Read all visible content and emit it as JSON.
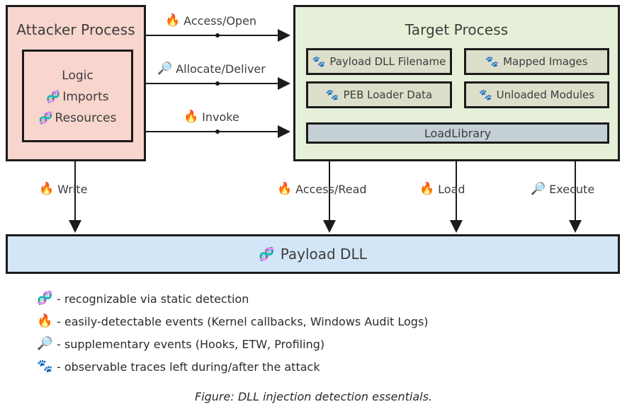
{
  "diagram": {
    "attacker_process": {
      "title": "Attacker Process",
      "inner": {
        "rows": [
          {
            "icon": "",
            "label": "Logic"
          },
          {
            "icon": "🧬",
            "label": "Imports"
          },
          {
            "icon": "🧬",
            "label": "Resources"
          }
        ]
      }
    },
    "target_process": {
      "title": "Target Process",
      "cells": [
        {
          "icon": "🐾",
          "label": "Payload DLL Filename"
        },
        {
          "icon": "🐾",
          "label": "Mapped Images"
        },
        {
          "icon": "🐾",
          "label": "PEB Loader Data"
        },
        {
          "icon": "🐾",
          "label": "Unloaded Modules"
        }
      ],
      "loadlibrary": {
        "icon": "",
        "label": "LoadLibrary"
      }
    },
    "payload_dll": {
      "icon": "🧬",
      "label": "Payload DLL"
    },
    "horizontal_arrows": [
      {
        "icon": "🔥",
        "label": "Access/Open"
      },
      {
        "icon": "🔎",
        "label": "Allocate/Deliver"
      },
      {
        "icon": "🔥",
        "label": "Invoke"
      }
    ],
    "vertical_arrows": [
      {
        "icon": "🔥",
        "label": "Write"
      },
      {
        "icon": "🔥",
        "label": "Access/Read"
      },
      {
        "icon": "🔥",
        "label": "Load"
      },
      {
        "icon": "🔎",
        "label": "Execute"
      }
    ]
  },
  "legend": {
    "items": [
      {
        "icon": "🧬",
        "text": "- recognizable via static detection"
      },
      {
        "icon": "🔥",
        "text": "- easily-detectable events (Kernel callbacks, Windows Audit Logs)"
      },
      {
        "icon": "🔎",
        "text": "- supplementary events (Hooks, ETW, Profiling)"
      },
      {
        "icon": "🐾",
        "text": "- observable traces left during/after the attack"
      }
    ]
  },
  "caption": "Figure: DLL injection detection essentials.",
  "colors": {
    "attacker_fill": "#f8d5cd",
    "target_fill": "#e6f0d8",
    "cell_fill": "#dcdfca",
    "loadlibrary_fill": "#c5d0d6",
    "payload_fill": "#d3e6f7",
    "stroke": "#1b1b1b",
    "text": "#3d3d3d"
  }
}
